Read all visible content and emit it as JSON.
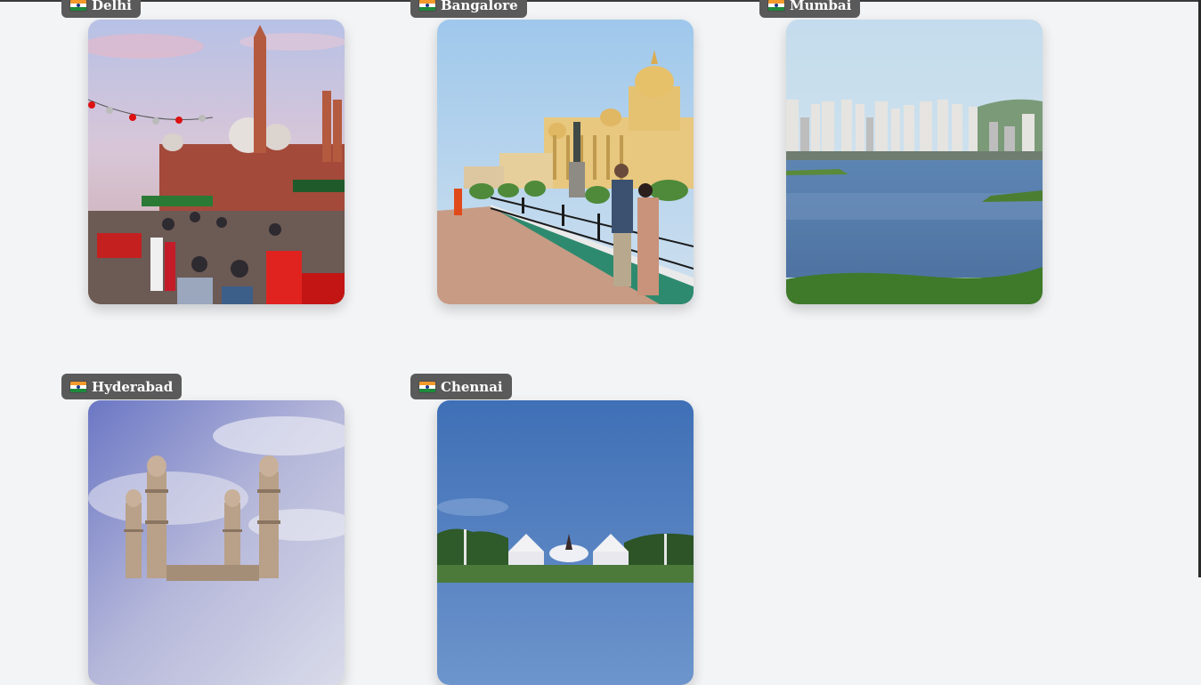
{
  "cities": [
    {
      "name": "Delhi",
      "flag": "india-flag-icon",
      "image": "delhi-photo"
    },
    {
      "name": "Bangalore",
      "flag": "india-flag-icon",
      "image": "bangalore-photo"
    },
    {
      "name": "Mumbai",
      "flag": "india-flag-icon",
      "image": "mumbai-photo"
    },
    {
      "name": "Hyderabad",
      "flag": "india-flag-icon",
      "image": "hyderabad-photo"
    },
    {
      "name": "Chennai",
      "flag": "india-flag-icon",
      "image": "chennai-photo"
    }
  ],
  "colors": {
    "background": "#f3f4f6",
    "tag_background": "#5a5a5a",
    "tag_text": "#ffffff",
    "flag_saffron": "#f39a2b",
    "flag_white": "#ffffff",
    "flag_green": "#1e8a3c",
    "flag_chakra": "#1e3a8a"
  }
}
